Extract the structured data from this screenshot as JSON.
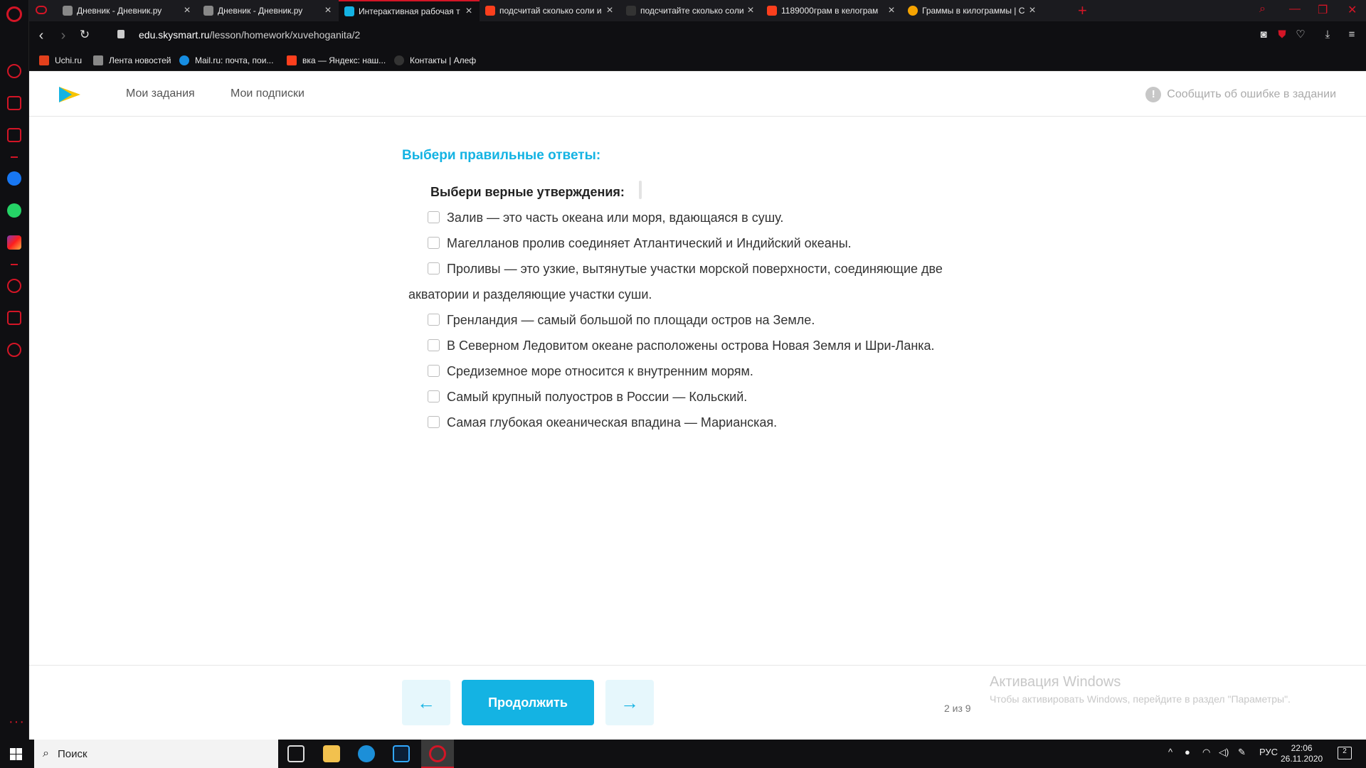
{
  "browser": {
    "tabs": [
      {
        "title": "Дневник - Дневник.ру",
        "active": false
      },
      {
        "title": "Дневник - Дневник.ру",
        "active": false
      },
      {
        "title": "Интерактивная рабочая т",
        "active": true
      },
      {
        "title": "подсчитай сколько соли и",
        "active": false
      },
      {
        "title": "подсчитайте сколько соли",
        "active": false
      },
      {
        "title": "1189000грам в келограм",
        "active": false
      },
      {
        "title": "Граммы в килограммы | С",
        "active": false
      }
    ],
    "url_domain": "edu.skysmart.ru",
    "url_path": "/lesson/homework/xuvehoganita/2",
    "bookmarks": [
      "Uchi.ru",
      "Лента новостей",
      "Mail.ru: почта, пои...",
      "вка — Яндекс: наш...",
      "Контакты | Алеф"
    ]
  },
  "site": {
    "nav": {
      "my_tasks": "Мои задания",
      "my_subscriptions": "Мои подписки"
    },
    "report_error": "Сообщить об ошибке в задании"
  },
  "task": {
    "instruction": "Выбери правильные ответы:",
    "question": "Выбери верные утверждения:",
    "options": [
      "Залив — это часть океана или моря, вдающаяся в сушу.",
      "Магелланов пролив соединяет Атлантический и Индийский океаны.",
      "Проливы — это узкие, вытянутые участки морской поверхности, соединяющие две",
      "акватории и разделяющие участки суши.",
      "Гренландия — самый большой по площади остров на Земле.",
      "В Северном Ледовитом океане расположены острова Новая Земля и Шри-Ланка.",
      "Средиземное море относится к внутренним морям.",
      "Самый крупный полуостров в России — Кольский.",
      "Самая глубокая океаническая впадина — Марианская."
    ]
  },
  "footer": {
    "prev_arrow": "←",
    "continue_label": "Продолжить",
    "next_arrow": "→",
    "progress": "2 из 9"
  },
  "windows_activation": {
    "title": "Активация Windows",
    "subtitle": "Чтобы активировать Windows, перейдите в раздел \"Параметры\"."
  },
  "taskbar": {
    "search_placeholder": "Поиск",
    "language": "РУС",
    "time": "22:06",
    "date": "26.11.2020",
    "notifications": "2"
  },
  "colors": {
    "accent": "#14b3e3",
    "opera_red": "#d31526"
  }
}
